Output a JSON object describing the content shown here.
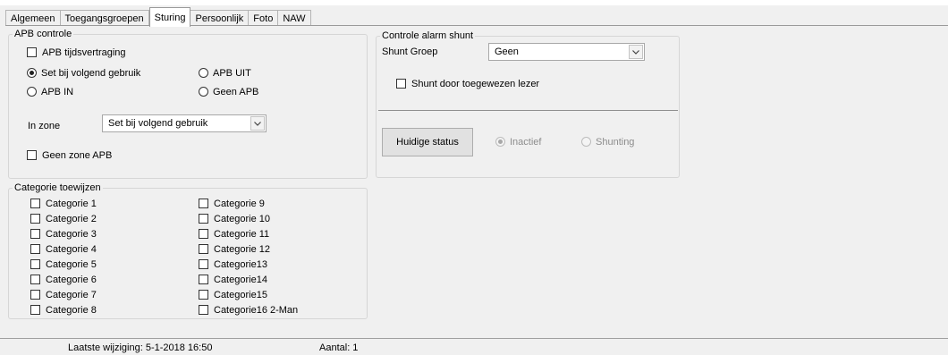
{
  "tabs": [
    "Algemeen",
    "Toegangsgroepen",
    "Sturing",
    "Persoonlijk",
    "Foto",
    "NAW"
  ],
  "active_tab": "Sturing",
  "apb": {
    "legend": "APB controle",
    "tijdsvertraging": "APB tijdsvertraging",
    "radio_set_bij": "Set bij volgend gebruik",
    "radio_apb_in": "APB IN",
    "radio_apb_uit": "APB UIT",
    "radio_geen_apb": "Geen APB",
    "selected_radio": "Set bij volgend gebruik",
    "in_zone_label": "In zone",
    "in_zone_value": "Set bij volgend gebruik",
    "geen_zone": "Geen zone APB"
  },
  "categorie": {
    "legend": "Categorie toewijzen",
    "items": [
      "Categorie 1",
      "Categorie 2",
      "Categorie 3",
      "Categorie 4",
      "Categorie 5",
      "Categorie 6",
      "Categorie 7",
      "Categorie 8",
      "Categorie 9",
      "Categorie 10",
      "Categorie 11",
      "Categorie 12",
      "Categorie13",
      "Categorie14",
      "Categorie15",
      "Categorie16 2-Man"
    ]
  },
  "shunt": {
    "legend": "Controle alarm shunt",
    "groep_label": "Shunt Groep",
    "groep_value": "Geen",
    "door_lezer": "Shunt door toegewezen lezer",
    "status_button": "Huidige status",
    "radio_inactief": "Inactief",
    "radio_shunting": "Shunting"
  },
  "statusbar": {
    "laatste_wijziging": "Laatste wijziging: 5-1-2018 16:50",
    "aantal": "Aantal: 1"
  }
}
